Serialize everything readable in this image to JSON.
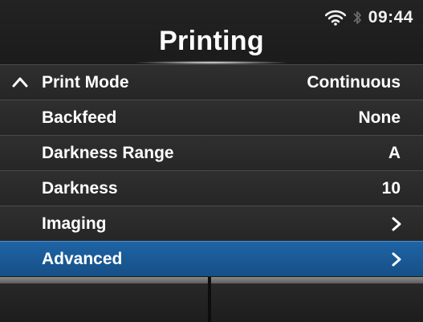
{
  "status_bar": {
    "time": "09:44",
    "wifi_icon": "wifi-icon",
    "bluetooth_icon": "bluetooth-icon"
  },
  "header": {
    "title": "Printing"
  },
  "menu": {
    "items": [
      {
        "label": "Print Mode",
        "value": "Continuous",
        "icon": "chevron-up-icon"
      },
      {
        "label": "Backfeed",
        "value": "None"
      },
      {
        "label": "Darkness Range",
        "value": "A"
      },
      {
        "label": "Darkness",
        "value": "10"
      },
      {
        "label": "Imaging",
        "value": "",
        "icon": "chevron-right-icon"
      },
      {
        "label": "Advanced",
        "value": "",
        "icon": "chevron-right-icon",
        "selected": true
      }
    ]
  },
  "colors": {
    "selected_row": "#1e64a6",
    "row_bg": "#2b2b2b",
    "text": "#ffffff"
  }
}
